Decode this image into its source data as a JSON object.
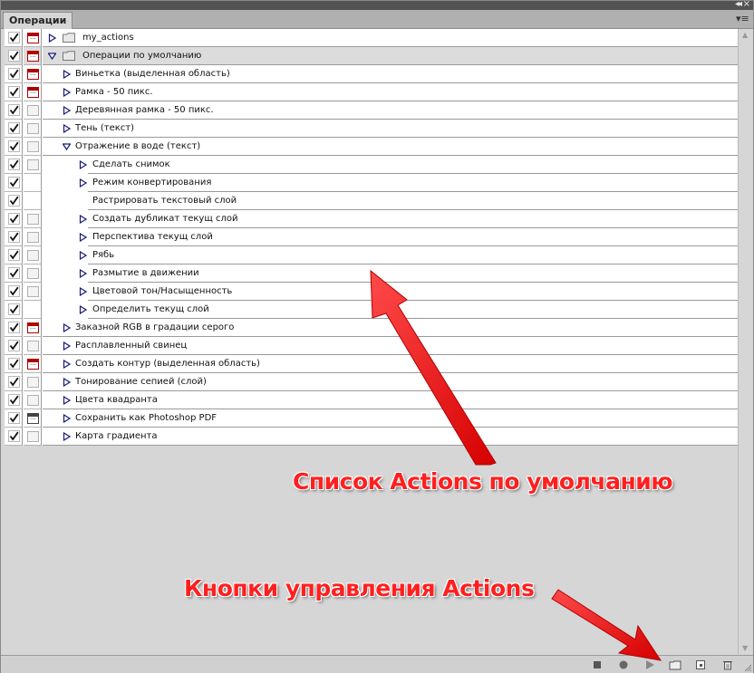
{
  "panel": {
    "tab_label": "Операции",
    "collapse_glyph": "◂◂",
    "close_glyph": "×",
    "menu_glyph": "▾≡"
  },
  "rows": [
    {
      "check": true,
      "dialog": "red",
      "indent": 0,
      "expand": "closed",
      "folder": true,
      "label": "my_actions",
      "selected": false
    },
    {
      "check": true,
      "dialog": "red",
      "indent": 0,
      "expand": "open",
      "folder": true,
      "label": "Операции по умолчанию",
      "selected": true
    },
    {
      "check": true,
      "dialog": "red",
      "indent": 1,
      "expand": "closed",
      "folder": false,
      "label": "Виньетка (выделенная область)",
      "selected": false
    },
    {
      "check": true,
      "dialog": "red",
      "indent": 1,
      "expand": "closed",
      "folder": false,
      "label": "Рамка - 50 пикс.",
      "selected": false
    },
    {
      "check": true,
      "dialog": "empty",
      "indent": 1,
      "expand": "closed",
      "folder": false,
      "label": "Деревянная рамка - 50 пикс.",
      "selected": false
    },
    {
      "check": true,
      "dialog": "empty",
      "indent": 1,
      "expand": "closed",
      "folder": false,
      "label": "Тень (текст)",
      "selected": false
    },
    {
      "check": true,
      "dialog": "empty",
      "indent": 1,
      "expand": "open",
      "folder": false,
      "label": "Отражение в воде (текст)",
      "selected": false
    },
    {
      "check": true,
      "dialog": "empty",
      "indent": 2,
      "expand": "closed",
      "folder": false,
      "label": "Сделать снимок",
      "selected": false
    },
    {
      "check": true,
      "dialog": "none",
      "indent": 2,
      "expand": "closed",
      "folder": false,
      "label": "Режим конвертирования",
      "selected": false
    },
    {
      "check": true,
      "dialog": "none",
      "indent": 2,
      "expand": "none",
      "folder": false,
      "label": "Растрировать текстовый слой",
      "selected": false
    },
    {
      "check": true,
      "dialog": "empty",
      "indent": 2,
      "expand": "closed",
      "folder": false,
      "label": "Создать дубликат текущ слой",
      "selected": false
    },
    {
      "check": true,
      "dialog": "empty",
      "indent": 2,
      "expand": "closed",
      "folder": false,
      "label": "Перспектива текущ слой",
      "selected": false
    },
    {
      "check": true,
      "dialog": "empty",
      "indent": 2,
      "expand": "closed",
      "folder": false,
      "label": "Рябь",
      "selected": false
    },
    {
      "check": true,
      "dialog": "empty",
      "indent": 2,
      "expand": "closed",
      "folder": false,
      "label": "Размытие в движении",
      "selected": false
    },
    {
      "check": true,
      "dialog": "empty",
      "indent": 2,
      "expand": "closed",
      "folder": false,
      "label": "Цветовой тон/Насыщенность",
      "selected": false
    },
    {
      "check": true,
      "dialog": "none",
      "indent": 2,
      "expand": "closed",
      "folder": false,
      "label": "Определить текущ слой",
      "selected": false
    },
    {
      "check": true,
      "dialog": "red",
      "indent": 1,
      "expand": "closed",
      "folder": false,
      "label": "Заказной RGB в градации серого",
      "selected": false
    },
    {
      "check": true,
      "dialog": "empty",
      "indent": 1,
      "expand": "closed",
      "folder": false,
      "label": "Расплавленный свинец",
      "selected": false
    },
    {
      "check": true,
      "dialog": "red",
      "indent": 1,
      "expand": "closed",
      "folder": false,
      "label": "Создать контур (выделенная область)",
      "selected": false
    },
    {
      "check": true,
      "dialog": "empty",
      "indent": 1,
      "expand": "closed",
      "folder": false,
      "label": "Тонирование сепией (слой)",
      "selected": false
    },
    {
      "check": true,
      "dialog": "empty",
      "indent": 1,
      "expand": "closed",
      "folder": false,
      "label": "Цвета квадранта",
      "selected": false
    },
    {
      "check": true,
      "dialog": "dark",
      "indent": 1,
      "expand": "closed",
      "folder": false,
      "label": "Сохранить как Photoshop PDF",
      "selected": false
    },
    {
      "check": true,
      "dialog": "empty",
      "indent": 1,
      "expand": "closed",
      "folder": false,
      "label": "Карта градиента",
      "selected": false
    }
  ],
  "annotations": {
    "list_caption": "Список Actions по умолчанию",
    "buttons_caption": "Кнопки управления Actions"
  },
  "toolbar": {
    "stop": "stop-icon",
    "record": "record-icon",
    "play": "play-icon",
    "new_set": "folder-icon",
    "new_action": "new-action-icon",
    "delete": "trash-icon"
  },
  "colors": {
    "annotation_red": "#ff1f1f",
    "dialog_red": "#b00000",
    "triangle_blue": "#1a1a7a",
    "panel_bg": "#d6d6d6"
  }
}
